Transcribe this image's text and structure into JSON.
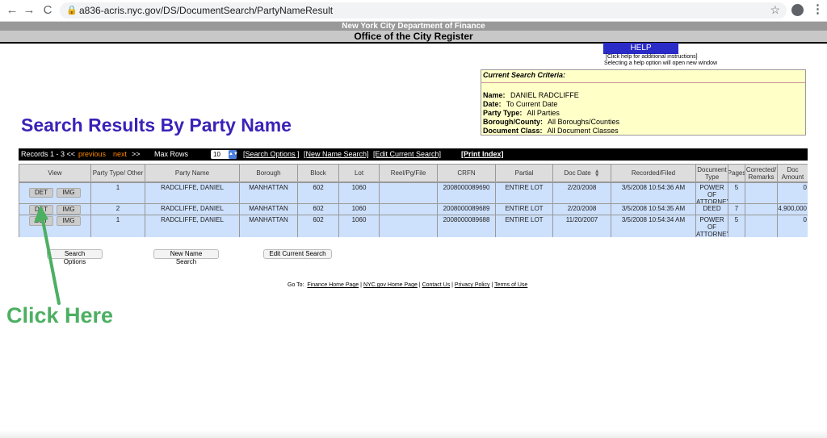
{
  "browser": {
    "url": "a836-acris.nyc.gov/DS/DocumentSearch/PartyNameResult",
    "back_icon": "←",
    "forward_icon": "→",
    "reload_icon": "C"
  },
  "header": {
    "department": "New York City Department of Finance",
    "office": "Office of the City Register"
  },
  "help": {
    "button": "HELP",
    "note_line1": "[Click help for additional instructions]",
    "note_line2": "Selecting a help option will open new window"
  },
  "criteria": {
    "title": "Current Search Criteria:",
    "name_label": "Name:",
    "name_value": "DANIEL RADCLIFFE",
    "date_label": "Date:",
    "date_value": "To Current Date",
    "party_label": "Party Type:",
    "party_value": "All Parties",
    "borough_label": "Borough/County:",
    "borough_value": "All Boroughs/Counties",
    "docclass_label": "Document Class:",
    "docclass_value": "All Document Classes"
  },
  "page_title": "Search Results By Party Name",
  "toolbar": {
    "records": "Records 1 - 3 <<",
    "previous": "previous",
    "next": "next",
    "next_arrows": ">>",
    "max_rows_label": "Max Rows",
    "max_rows_value": "10",
    "search_options": "[Search Options ]",
    "new_name_search": "[New Name Search]",
    "edit_current_search": "[Edit Current Search]",
    "print_index": "[Print Index]"
  },
  "table": {
    "headers": [
      "View",
      "Party Type/ Other",
      "Party Name",
      "Borough",
      "Block",
      "Lot",
      "Reel/Pg/File",
      "CRFN",
      "Partial",
      "Doc Date",
      "Recorded/Filed",
      "Document Type",
      "Pages",
      "Corrected/ Remarks",
      "Doc Amount"
    ],
    "det_label": "DET",
    "img_label": "IMG",
    "rows": [
      {
        "party_type": "1",
        "party_name": "RADCLIFFE, DANIEL",
        "borough": "MANHATTAN",
        "block": "602",
        "lot": "1060",
        "reel": "",
        "crfn": "2008000089690",
        "partial": "ENTIRE LOT",
        "doc_date": "2/20/2008",
        "recorded": "3/5/2008 10:54:36 AM",
        "doc_type": "POWER OF ATTORNEY",
        "pages": "5",
        "remarks": "",
        "amount": "0"
      },
      {
        "party_type": "2",
        "party_name": "RADCLIFFE, DANIEL",
        "borough": "MANHATTAN",
        "block": "602",
        "lot": "1060",
        "reel": "",
        "crfn": "2008000089689",
        "partial": "ENTIRE LOT",
        "doc_date": "2/20/2008",
        "recorded": "3/5/2008 10:54:35 AM",
        "doc_type": "DEED",
        "pages": "7",
        "remarks": "",
        "amount": "4,900,000"
      },
      {
        "party_type": "1",
        "party_name": "RADCLIFFE, DANIEL",
        "borough": "MANHATTAN",
        "block": "602",
        "lot": "1060",
        "reel": "",
        "crfn": "2008000089688",
        "partial": "ENTIRE LOT",
        "doc_date": "11/20/2007",
        "recorded": "3/5/2008 10:54:34 AM",
        "doc_type": "POWER OF ATTORNEY",
        "pages": "5",
        "remarks": "",
        "amount": "0"
      }
    ]
  },
  "bottom_buttons": {
    "search_options": "Search Options",
    "new_name_search": "New Name Search",
    "edit_current_search": "Edit Current Search"
  },
  "footer": {
    "goto": "Go To:",
    "finance": "Finance Home Page",
    "nycgov": "NYC.gov Home Page",
    "contact": "Contact Us",
    "privacy": "Privacy Policy",
    "terms": "Terms of Use"
  },
  "annotation": {
    "text": "Click Here",
    "color": "#4caf62"
  }
}
